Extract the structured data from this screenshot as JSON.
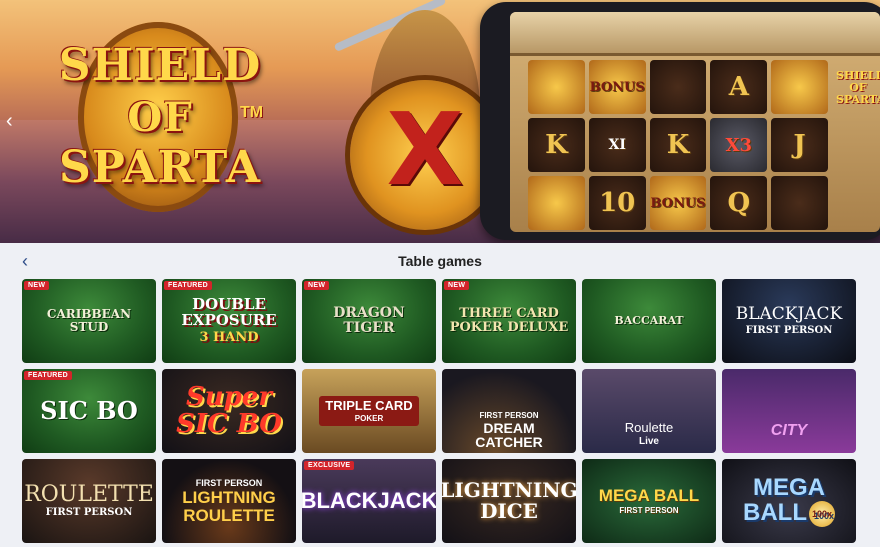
{
  "banner": {
    "logo_line1": "SHIELD",
    "logo_line2": "OF",
    "logo_line3": "SPARTA",
    "logo_tm": "TM",
    "prev_arrow": "‹",
    "shield_mark": "X",
    "side_title": "SHIELD OF SPARTA",
    "reels": [
      "",
      "BONUS",
      "",
      "A",
      "",
      "K",
      "XI",
      "K",
      "X3",
      "J",
      "",
      "10",
      "BONUS",
      "Q",
      ""
    ]
  },
  "section": {
    "back_label": "‹",
    "title": "Table games"
  },
  "games": [
    {
      "tag": "NEW",
      "name": "CARIBBEAN STUD",
      "sub": ""
    },
    {
      "tag": "FEATURED",
      "name": "DOUBLE EXPOSURE",
      "sub": "3 HAND"
    },
    {
      "tag": "NEW",
      "name": "DRAGON TIGER",
      "sub": ""
    },
    {
      "tag": "NEW",
      "name": "THREE CARD POKER DELUXE",
      "sub": ""
    },
    {
      "tag": "",
      "name": "BACCARAT",
      "sub": ""
    },
    {
      "tag": "",
      "name": "BLACKJACK",
      "sub": "FIRST PERSON"
    },
    {
      "tag": "FEATURED",
      "name": "SIC BO",
      "sub": ""
    },
    {
      "tag": "",
      "name": "Super SIC BO",
      "sub": ""
    },
    {
      "tag": "",
      "name": "TRIPLE CARD",
      "sub": "POKER"
    },
    {
      "tag": "",
      "name": "DREAM CATCHER",
      "sub": "FIRST PERSON"
    },
    {
      "tag": "",
      "name": "Roulette",
      "sub": "Live"
    },
    {
      "tag": "",
      "name": "CITY",
      "sub": ""
    },
    {
      "tag": "",
      "name": "ROULETTE",
      "sub": "FIRST PERSON"
    },
    {
      "tag": "",
      "name": "LIGHTNING ROULETTE",
      "sub": "FIRST PERSON"
    },
    {
      "tag": "EXCLUSIVE",
      "name": "BLACKJACK",
      "sub": ""
    },
    {
      "tag": "",
      "name": "LIGHTNING DICE",
      "sub": ""
    },
    {
      "tag": "",
      "name": "MEGA BALL",
      "sub": "FIRST PERSON"
    },
    {
      "tag": "",
      "name": "MEGA BALL",
      "sub": "100x"
    }
  ]
}
